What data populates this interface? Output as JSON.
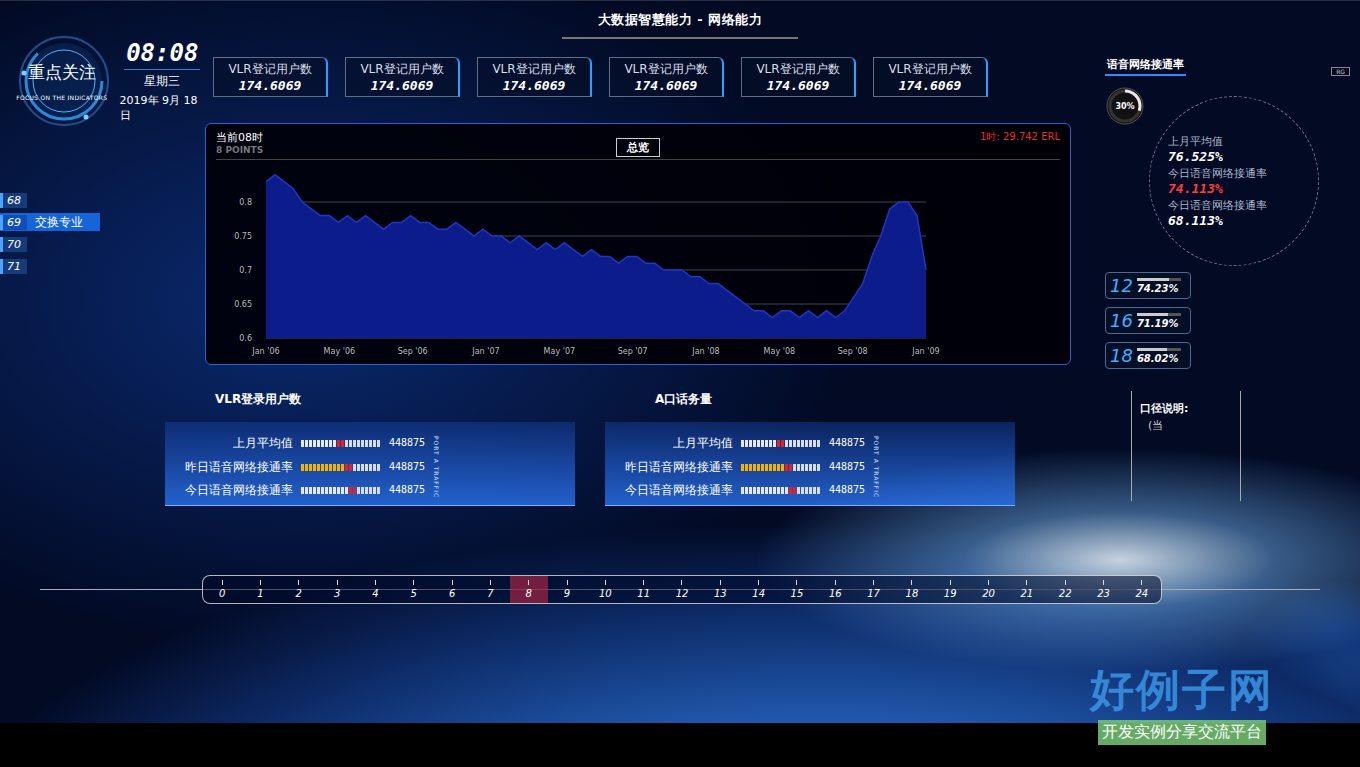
{
  "header": {
    "title": "大数据智慧能力 - 网络能力"
  },
  "focus": {
    "title": "重点关注",
    "subtitle": "FOCUS ON THE INDICATORS",
    "time": "08:08",
    "weekday": "星期三",
    "date": "2019年 9月 18日"
  },
  "sidebar": {
    "items": [
      {
        "number": "68",
        "label": "",
        "selected": false
      },
      {
        "number": "69",
        "label": "交换专业",
        "selected": true
      },
      {
        "number": "70",
        "label": "",
        "selected": false
      },
      {
        "number": "71",
        "label": "",
        "selected": false
      }
    ]
  },
  "stat_cards": [
    {
      "label": "VLR登记用户数",
      "value": "174.6069"
    },
    {
      "label": "VLR登记用户数",
      "value": "174.6069"
    },
    {
      "label": "VLR登记用户数",
      "value": "174.6069"
    },
    {
      "label": "VLR登记用户数",
      "value": "174.6069"
    },
    {
      "label": "VLR登记用户数",
      "value": "174.6069"
    },
    {
      "label": "VLR登记用户数",
      "value": "174.6069"
    }
  ],
  "chart": {
    "current": "当前08时",
    "points": "8 POINTS",
    "tab": "总览",
    "reading": "1时: 29.742 ERL",
    "y_ticks": [
      "0.8",
      "0.75",
      "0.7",
      "0.65",
      "0.6"
    ],
    "x_ticks": [
      "Jan '06",
      "May '06",
      "Sep '06",
      "Jan '07",
      "May '07",
      "Sep '07",
      "Jan '08",
      "May '08",
      "Sep '08",
      "Jan '09"
    ],
    "series": [
      {
        "name": "总览",
        "values": [
          0.83,
          0.84,
          0.83,
          0.82,
          0.8,
          0.79,
          0.78,
          0.78,
          0.77,
          0.78,
          0.77,
          0.78,
          0.77,
          0.76,
          0.77,
          0.77,
          0.78,
          0.77,
          0.77,
          0.76,
          0.76,
          0.77,
          0.76,
          0.75,
          0.76,
          0.75,
          0.75,
          0.74,
          0.75,
          0.74,
          0.73,
          0.74,
          0.73,
          0.74,
          0.73,
          0.72,
          0.73,
          0.72,
          0.72,
          0.71,
          0.72,
          0.72,
          0.71,
          0.71,
          0.7,
          0.7,
          0.7,
          0.69,
          0.69,
          0.68,
          0.68,
          0.67,
          0.66,
          0.65,
          0.64,
          0.64,
          0.63,
          0.64,
          0.64,
          0.63,
          0.64,
          0.63,
          0.64,
          0.63,
          0.64,
          0.66,
          0.68,
          0.72,
          0.75,
          0.79,
          0.8,
          0.8,
          0.78,
          0.7
        ]
      }
    ]
  },
  "panels": [
    {
      "title": "VLR登录用户数",
      "side_label": "PORT A TRAFFIC",
      "rows": [
        {
          "label": "上月平均值",
          "value": "448875",
          "level": 0.45,
          "color": "#e6e8ee"
        },
        {
          "label": "昨日语音网络接通率",
          "value": "448875",
          "level": 0.55,
          "color": "#f0b400"
        },
        {
          "label": "今日语音网络接通率",
          "value": "448875",
          "level": 0.6,
          "color": "#e6e8ee"
        }
      ]
    },
    {
      "title": "A口话务量",
      "side_label": "PORT A TRAFFIC",
      "rows": [
        {
          "label": "上月平均值",
          "value": "448875",
          "level": 0.45,
          "color": "#e6e8ee"
        },
        {
          "label": "昨日语音网络接通率",
          "value": "448875",
          "level": 0.55,
          "color": "#f0b400"
        },
        {
          "label": "今日语音网络接通率",
          "value": "448875",
          "level": 0.6,
          "color": "#e6e8ee"
        }
      ]
    }
  ],
  "timeline": {
    "hours": [
      {
        "label": "0",
        "selected": false
      },
      {
        "label": "1",
        "selected": false
      },
      {
        "label": "2",
        "selected": false
      },
      {
        "label": "3",
        "selected": false
      },
      {
        "label": "4",
        "selected": false
      },
      {
        "label": "5",
        "selected": false
      },
      {
        "label": "6",
        "selected": false
      },
      {
        "label": "7",
        "selected": false
      },
      {
        "label": "8",
        "selected": true
      },
      {
        "label": "9",
        "selected": false
      },
      {
        "label": "10",
        "selected": false
      },
      {
        "label": "11",
        "selected": false
      },
      {
        "label": "12",
        "selected": false
      },
      {
        "label": "13",
        "selected": false
      },
      {
        "label": "14",
        "selected": false
      },
      {
        "label": "15",
        "selected": false
      },
      {
        "label": "16",
        "selected": false
      },
      {
        "label": "17",
        "selected": false
      },
      {
        "label": "18",
        "selected": false
      },
      {
        "label": "19",
        "selected": false
      },
      {
        "label": "20",
        "selected": false
      },
      {
        "label": "21",
        "selected": false
      },
      {
        "label": "22",
        "selected": false
      },
      {
        "label": "23",
        "selected": false
      },
      {
        "label": "24",
        "selected": false
      }
    ]
  },
  "rate": {
    "title": "语音网络接通率",
    "tag": "RG",
    "ring_label": "30%",
    "ring_level": 0.3,
    "items": [
      {
        "label": "上月平均值",
        "value": "76.525%",
        "color": "#ffffff"
      },
      {
        "label": "今日语音网络接通率",
        "value": "74.113%",
        "color": "#ff3b3b"
      },
      {
        "label": "今日语音网络接通率",
        "value": "68.113%",
        "color": "#ffffff"
      }
    ]
  },
  "hourly": [
    {
      "hour": "12",
      "value": "74.23%",
      "level": 0.74
    },
    {
      "hour": "16",
      "value": "71.19%",
      "level": 0.71
    },
    {
      "hour": "18",
      "value": "68.02%",
      "level": 0.68
    }
  ],
  "note": {
    "title": "口径说明:",
    "text": "(当"
  },
  "watermark": {
    "title": "好例子网",
    "subtitle": "开发实例分享交流平台"
  }
}
